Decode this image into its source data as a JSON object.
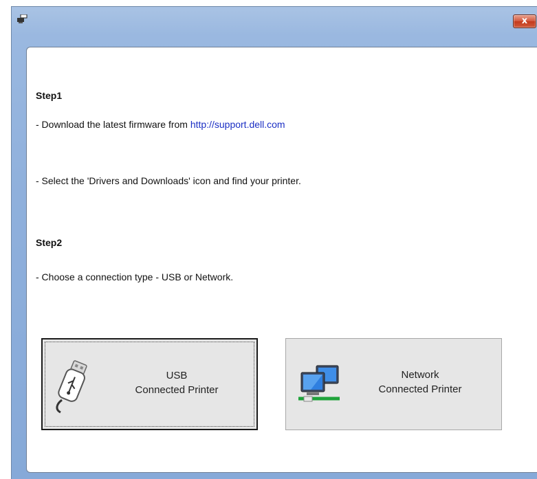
{
  "window": {
    "close_label": "x"
  },
  "step1": {
    "heading": "Step1",
    "line1_prefix": "- Download the latest firmware from ",
    "line1_link": "http://support.dell.com",
    "line2": "- Select the 'Drivers and Downloads' icon and find your printer."
  },
  "step2": {
    "heading": "Step2",
    "line1": "- Choose a connection type - USB or Network."
  },
  "buttons": {
    "usb": {
      "line1": "USB",
      "line2": "Connected Printer",
      "icon": "usb-drive-icon"
    },
    "network": {
      "line1": "Network",
      "line2": "Connected Printer",
      "icon": "network-computers-icon"
    }
  }
}
